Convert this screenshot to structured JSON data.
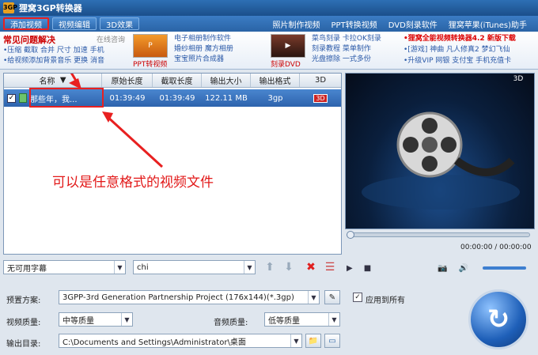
{
  "app": {
    "title": "狸窝3GP转换器",
    "icon_text": "3GP"
  },
  "toolbar": {
    "tabs": [
      "添加视频",
      "视频编辑",
      "3D效果"
    ],
    "links": [
      "照片制作视频",
      "PPT转换视频",
      "DVD刻录软件",
      "狸窝苹果(iTunes)助手"
    ]
  },
  "banner": {
    "faq_title": "常见问题解决",
    "faq_online": "在线咨询",
    "faq_lines": [
      "•压缩 截取 合并 尺寸 加速 手机",
      "•给视频添加背景音乐 更换 消音"
    ],
    "promo1_caption": "PPT转视频",
    "promo1_links": [
      "电子相册制作软件",
      "婚纱相册 魔方相册",
      "宝宝照片合成器"
    ],
    "promo2_caption": "刻录DVD",
    "promo2_links": [
      "菜鸟刻录 卡拉OK刻录",
      "刻录教程 菜单制作",
      "光盘擦除 一式多份"
    ],
    "news": [
      "•狸窝全能视频转换器4.2 新版下载",
      "•[游戏] 神曲 凡人修真2 梦幻飞仙",
      "•升级VIP 网银 支付宝 手机充值卡"
    ]
  },
  "table": {
    "headers": [
      "名称",
      "原始长度",
      "截取长度",
      "输出大小",
      "输出格式",
      "3D"
    ],
    "rows": [
      {
        "name": "那些年，我...",
        "orig": "01:39:49",
        "cut": "01:39:49",
        "size": "122.11 MB",
        "format": "3gp",
        "three_d": "3D"
      }
    ]
  },
  "player": {
    "timecode": "00:00:00 / 00:00:00",
    "progress": 0
  },
  "subtitle": {
    "value": "无可用字幕"
  },
  "audio": {
    "value": "chi"
  },
  "settings": {
    "preset_label": "预置方案:",
    "preset_value": "3GPP-3rd Generation Partnership Project (176x144)(*.3gp)",
    "apply_all": "应用到所有",
    "video_quality_label": "视频质量:",
    "video_quality_value": "中等质量",
    "audio_quality_label": "音频质量:",
    "audio_quality_value": "低等质量",
    "output_label": "输出目录:",
    "output_value": "C:\\Documents and Settings\\Administrator\\桌面"
  },
  "annotation": "可以是任意格式的视频文件",
  "colors": {
    "accent": "#2d6fb4",
    "highlight": "#e82020"
  }
}
